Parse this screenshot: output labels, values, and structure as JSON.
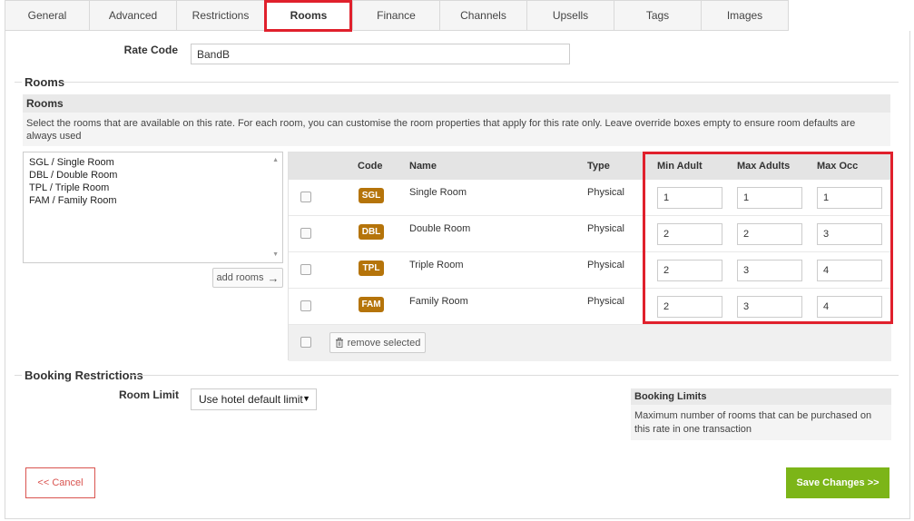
{
  "tabs": [
    {
      "label": "General"
    },
    {
      "label": "Advanced"
    },
    {
      "label": "Restrictions"
    },
    {
      "label": "Rooms"
    },
    {
      "label": "Finance"
    },
    {
      "label": "Channels"
    },
    {
      "label": "Upsells"
    },
    {
      "label": "Tags"
    },
    {
      "label": "Images"
    }
  ],
  "active_tab": "Rooms",
  "rate_code": {
    "label": "Rate Code",
    "value": "BandB"
  },
  "rooms_section": {
    "legend": "Rooms",
    "info_title": "Rooms",
    "info_text": "Select the rooms that are available on this rate. For each room, you can customise the room properties that apply for this rate only. Leave override boxes empty to ensure room defaults are always used",
    "available_rooms": [
      "SGL / Single Room",
      "DBL / Double Room",
      "TPL / Triple Room",
      "FAM / Family Room"
    ],
    "add_button": "add rooms",
    "columns": {
      "code": "Code",
      "name": "Name",
      "type": "Type",
      "min_adult": "Min Adult",
      "max_adults": "Max Adults",
      "max_occ": "Max Occ"
    },
    "rows": [
      {
        "code": "SGL",
        "name": "Single Room",
        "type": "Physical",
        "min_adult": "1",
        "max_adults": "1",
        "max_occ": "1"
      },
      {
        "code": "DBL",
        "name": "Double Room",
        "type": "Physical",
        "min_adult": "2",
        "max_adults": "2",
        "max_occ": "3"
      },
      {
        "code": "TPL",
        "name": "Triple Room",
        "type": "Physical",
        "min_adult": "2",
        "max_adults": "3",
        "max_occ": "4"
      },
      {
        "code": "FAM",
        "name": "Family Room",
        "type": "Physical",
        "min_adult": "2",
        "max_adults": "3",
        "max_occ": "4"
      }
    ],
    "remove_button": "remove selected"
  },
  "booking_restrictions": {
    "legend": "Booking Restrictions",
    "room_limit_label": "Room Limit",
    "room_limit_value": "Use hotel default limit",
    "limits_title": "Booking Limits",
    "limits_text": "Maximum number of rooms that can be purchased on this rate in one transaction"
  },
  "actions": {
    "cancel": "<< Cancel",
    "save": "Save Changes >>"
  },
  "colors": {
    "accent_red": "#e0202c",
    "badge": "#b5740a",
    "save_green": "#7cb518",
    "cancel_red": "#d9534f"
  }
}
